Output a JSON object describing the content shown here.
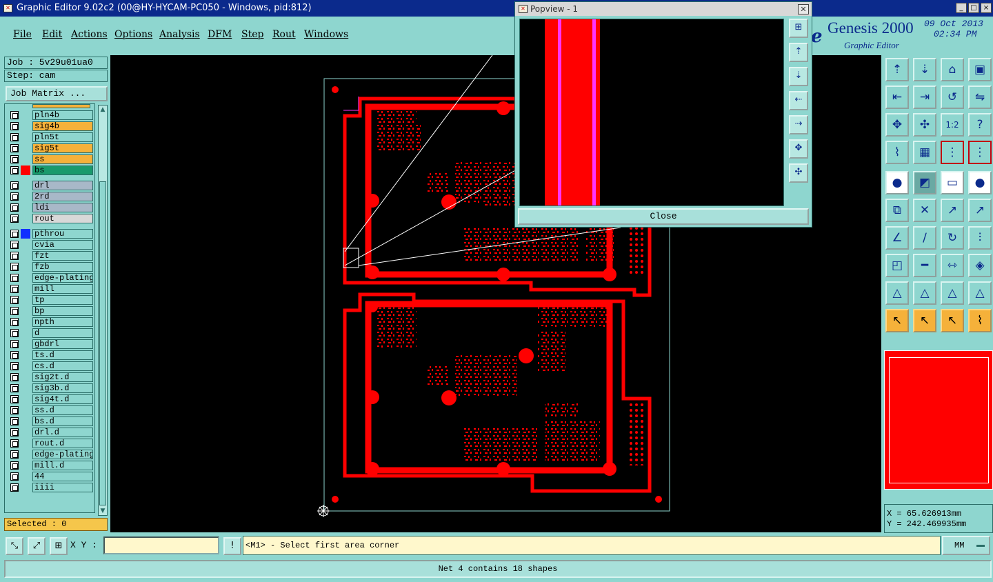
{
  "window": {
    "title": "Graphic Editor 9.02c2 (00@HY-HYCAM-PC050 - Windows, pid:812)",
    "controls": [
      "_",
      "□",
      "×"
    ]
  },
  "menu": [
    "File",
    "Edit",
    "Actions",
    "Options",
    "Analysis",
    "DFM",
    "Step",
    "Rout",
    "Windows"
  ],
  "brand": {
    "logo_letter": "e",
    "name": "Genesis 2000",
    "subtitle": "Graphic Editor",
    "date": "09 Oct 2013",
    "time": "02:34 PM"
  },
  "left_panel": {
    "job": "Job : 5v29u01ua0",
    "step": "Step: cam",
    "job_matrix": "Job Matrix ...",
    "selected": "Selected : 0",
    "layers": [
      {
        "name": "pln4b",
        "color": "#8ed6cf",
        "swatch": ""
      },
      {
        "name": "sig4b",
        "color": "#f5b13a",
        "swatch": ""
      },
      {
        "name": "pln5t",
        "color": "#8ed6cf",
        "swatch": ""
      },
      {
        "name": "sig5t",
        "color": "#f5b13a",
        "swatch": ""
      },
      {
        "name": "ss",
        "color": "#f5b13a",
        "swatch": ""
      },
      {
        "name": "bs",
        "color": "#1a9a6c",
        "swatch": "#ff0000"
      },
      {
        "name": "drl",
        "color": "#a8b8c8",
        "swatch": ""
      },
      {
        "name": "2rd",
        "color": "#a8b8c8",
        "swatch": ""
      },
      {
        "name": "ldi",
        "color": "#a8b8c8",
        "swatch": ""
      },
      {
        "name": "rout",
        "color": "#d8d8d8",
        "swatch": ""
      },
      {
        "name": "pthrou",
        "color": "#8ed6cf",
        "swatch": "#1030ff"
      },
      {
        "name": "cvia",
        "color": "#8ed6cf",
        "swatch": ""
      },
      {
        "name": "fzt",
        "color": "#8ed6cf",
        "swatch": ""
      },
      {
        "name": "fzb",
        "color": "#8ed6cf",
        "swatch": ""
      },
      {
        "name": "edge-plating",
        "color": "#8ed6cf",
        "swatch": ""
      },
      {
        "name": "mill",
        "color": "#8ed6cf",
        "swatch": ""
      },
      {
        "name": "tp",
        "color": "#8ed6cf",
        "swatch": ""
      },
      {
        "name": "bp",
        "color": "#8ed6cf",
        "swatch": ""
      },
      {
        "name": "npth",
        "color": "#8ed6cf",
        "swatch": ""
      },
      {
        "name": "d",
        "color": "#8ed6cf",
        "swatch": ""
      },
      {
        "name": "gbdrl",
        "color": "#8ed6cf",
        "swatch": ""
      },
      {
        "name": "ts.d",
        "color": "#8ed6cf",
        "swatch": ""
      },
      {
        "name": "cs.d",
        "color": "#8ed6cf",
        "swatch": ""
      },
      {
        "name": "sig2t.d",
        "color": "#8ed6cf",
        "swatch": ""
      },
      {
        "name": "sig3b.d",
        "color": "#8ed6cf",
        "swatch": ""
      },
      {
        "name": "sig4t.d",
        "color": "#8ed6cf",
        "swatch": ""
      },
      {
        "name": "ss.d",
        "color": "#8ed6cf",
        "swatch": ""
      },
      {
        "name": "bs.d",
        "color": "#8ed6cf",
        "swatch": ""
      },
      {
        "name": "drl.d",
        "color": "#8ed6cf",
        "swatch": ""
      },
      {
        "name": "rout.d",
        "color": "#8ed6cf",
        "swatch": ""
      },
      {
        "name": "edge-plating",
        "color": "#8ed6cf",
        "swatch": ""
      },
      {
        "name": "mill.d",
        "color": "#8ed6cf",
        "swatch": ""
      },
      {
        "name": "44",
        "color": "#8ed6cf",
        "swatch": ""
      },
      {
        "name": "iiii",
        "color": "#8ed6cf",
        "swatch": ""
      }
    ]
  },
  "popview": {
    "title": "Popview - 1",
    "close_label": "Close"
  },
  "right_panel": {
    "x": "X =  65.626913mm",
    "y": "Y = 242.469935mm"
  },
  "bottom": {
    "xy_label": "X Y :",
    "xy_value": "",
    "prompt": "<M1> - Select first area corner",
    "units": "MM",
    "status": "Net 4 contains 18 shapes"
  },
  "colors": {
    "background": "#8ed6cf",
    "layer_red": "#ff0000",
    "canvas": "#000000",
    "highlight_magenta": "#ff33ff"
  }
}
